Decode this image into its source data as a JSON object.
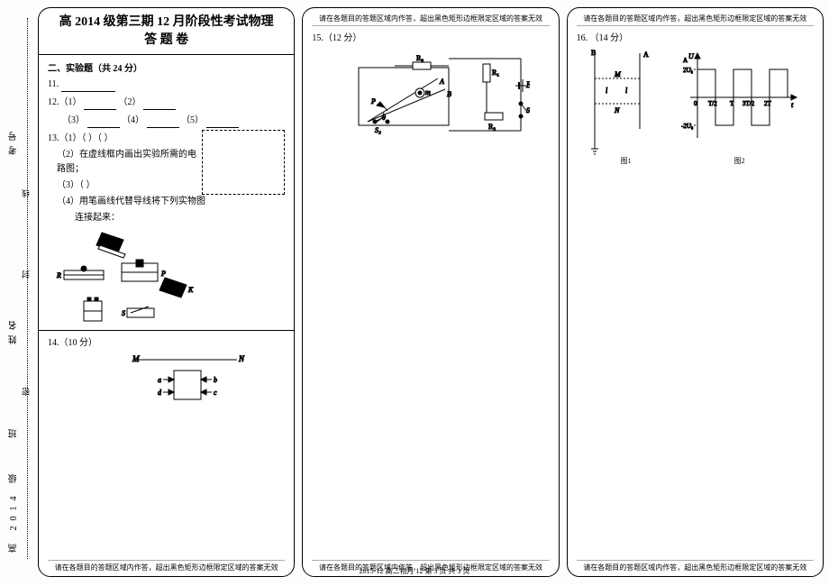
{
  "binding": {
    "grade": "高 2014 级",
    "class": "班",
    "seal": "密",
    "name": "姓名",
    "fold": "封",
    "line": "线",
    "number": "考号"
  },
  "col1": {
    "title_line1": "高 2014 级第三期 12 月阶段性考试物理",
    "title_line2": "答 题 卷",
    "section": "二、实验题（共 24 分）",
    "q11_label": "11.",
    "q12_label": "12.（1）",
    "q12_2": "（2）",
    "q12_3": "（3）",
    "q12_4": "（4）",
    "q12_5": "（5）",
    "q13_label": "13.（1）（        ）（        ）",
    "q13_2": "（2）在虚线框内画出实验所需的电路图；",
    "q13_3": "（3）（        ）",
    "q13_4a": "（4）用笔画线代替导线将下列实物图",
    "q13_4b": "连接起来：",
    "q14_label": "14.（10 分）",
    "footer": "请在各题目的答题区域内作答，超出黑色矩形边框限定区域的答案无效"
  },
  "col2": {
    "header": "请在各题目的答题区域内作答，超出黑色矩形边框限定区域的答案无效",
    "q15_label": "15.（12 分）",
    "footer": "请在各题目的答题区域内作答，超出黑色矩形边框限定区域的答案无效"
  },
  "col3": {
    "header": "请在各题目的答题区域内作答，超出黑色矩形边框限定区域的答案无效",
    "q16_label": "16.  （14 分）",
    "fig1_label": "图1",
    "fig2_label": "图2",
    "footer": "请在各题目的答题区域内作答，超出黑色矩形边框限定区域的答案无效"
  },
  "page_footer": "2015-12   高二物月 12   第 3 页   共  3  页"
}
